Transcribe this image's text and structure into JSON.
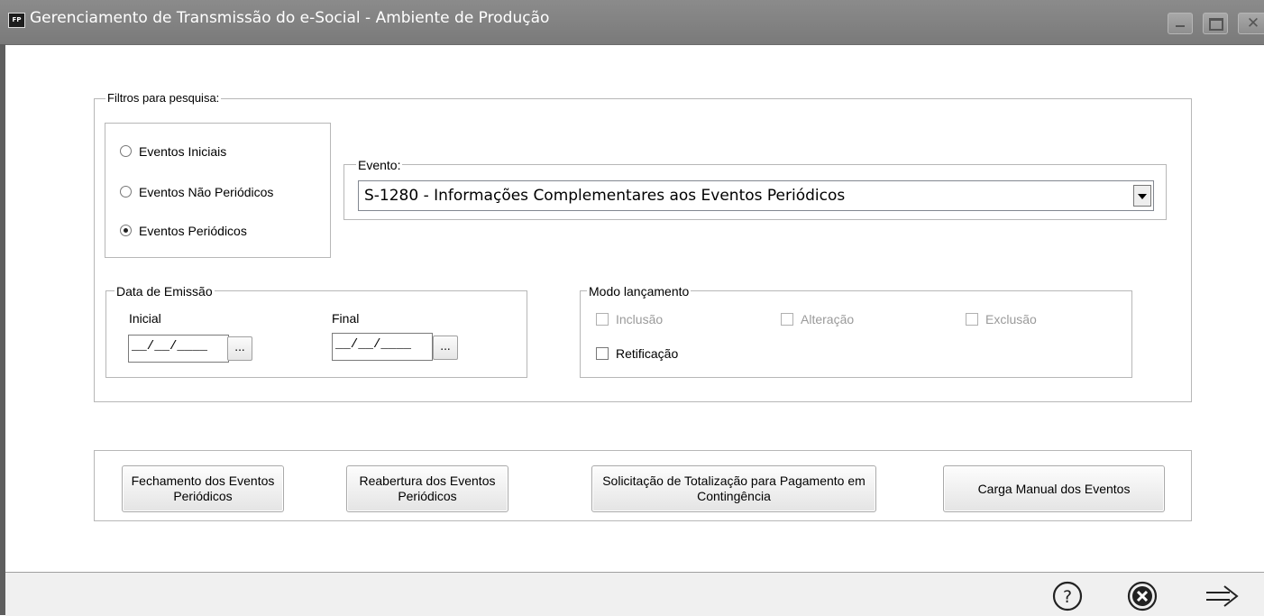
{
  "window": {
    "title": "Gerenciamento de Transmissão do e-Social - Ambiente de Produção",
    "icon_label": "FP"
  },
  "filtros": {
    "legend": "Filtros para pesquisa:",
    "radios": [
      {
        "label": "Eventos Iniciais",
        "selected": false
      },
      {
        "label": "Eventos Não Periódicos",
        "selected": false
      },
      {
        "label": "Eventos Periódicos",
        "selected": true
      }
    ],
    "evento": {
      "legend": "Evento:",
      "value": "S-1280 - Informações Complementares aos Eventos Periódicos"
    }
  },
  "data_emissao": {
    "legend": "Data de Emissão",
    "inicial_label": "Inicial",
    "inicial_value": "__/__/____",
    "final_label": "Final",
    "final_value": "__/__/____",
    "picker_label": "..."
  },
  "modo": {
    "legend": "Modo lançamento",
    "options": [
      {
        "label": "Inclusão",
        "enabled": false
      },
      {
        "label": "Alteração",
        "enabled": false
      },
      {
        "label": "Exclusão",
        "enabled": false
      },
      {
        "label": "Retificação",
        "enabled": true
      }
    ]
  },
  "actions": {
    "fechamento": "Fechamento dos Eventos Periódicos",
    "reabertura": "Reabertura dos Eventos Periódicos",
    "solicitacao": "Solicitação de Totalização para Pagamento em Contingência",
    "carga": "Carga Manual dos Eventos"
  },
  "footer": {
    "icons": [
      "help-icon",
      "cancel-icon",
      "next-arrow-icon"
    ]
  }
}
